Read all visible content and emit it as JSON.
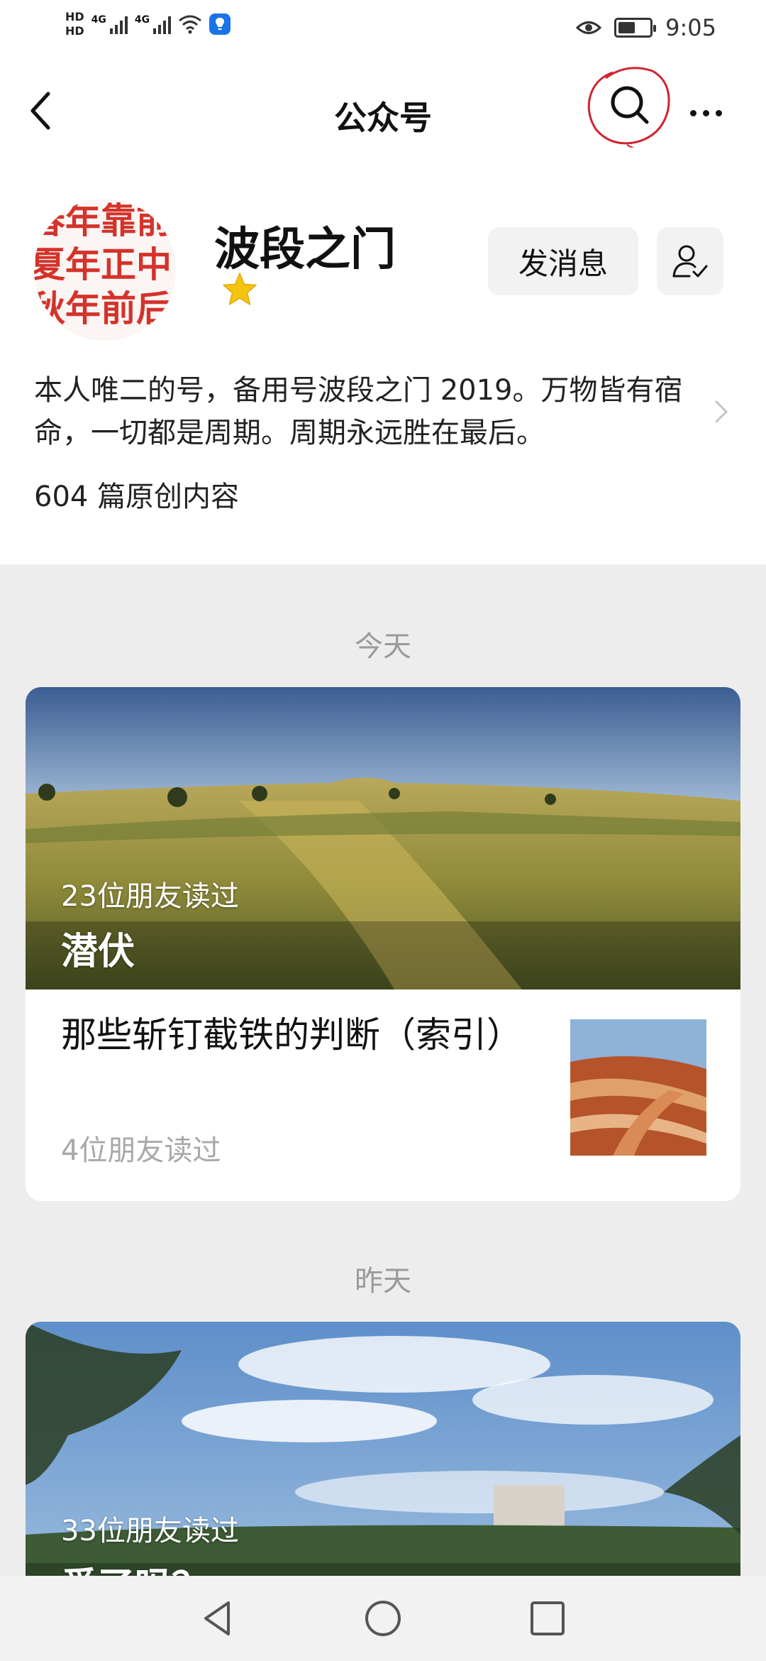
{
  "status_bar": {
    "hd1": "HD",
    "hd2": "HD",
    "net1": "4G",
    "net2": "4G",
    "time": "9:05",
    "battery_level": 0.55
  },
  "nav": {
    "title": "公众号",
    "back_icon": "back-arrow-icon",
    "search_icon": "search-icon",
    "more_icon": "more-dots-icon"
  },
  "profile": {
    "avatar_lines": [
      "春年靠前",
      "夏年正中",
      "秋年前后"
    ],
    "name": "波段之门",
    "send_message_label": "发消息",
    "description": "本人唯二的号，备用号波段之门 2019。万物皆有宿命，一切都是周期。周期永远胜在最后。",
    "original_count": "604 篇原创内容"
  },
  "sections": [
    {
      "day": "今天",
      "cover_readers": "23位朋友读过",
      "cover_title": "潜伏",
      "article_title": "那些斩钉截铁的判断（索引）",
      "article_readers": "4位朋友读过"
    },
    {
      "day": "昨天",
      "cover_readers": "33位朋友读过",
      "cover_title": "爱了吗？"
    }
  ],
  "colors": {
    "accent_red_annotation": "#d0242e",
    "star": "#f5c40f",
    "page_bg": "#ededed"
  }
}
